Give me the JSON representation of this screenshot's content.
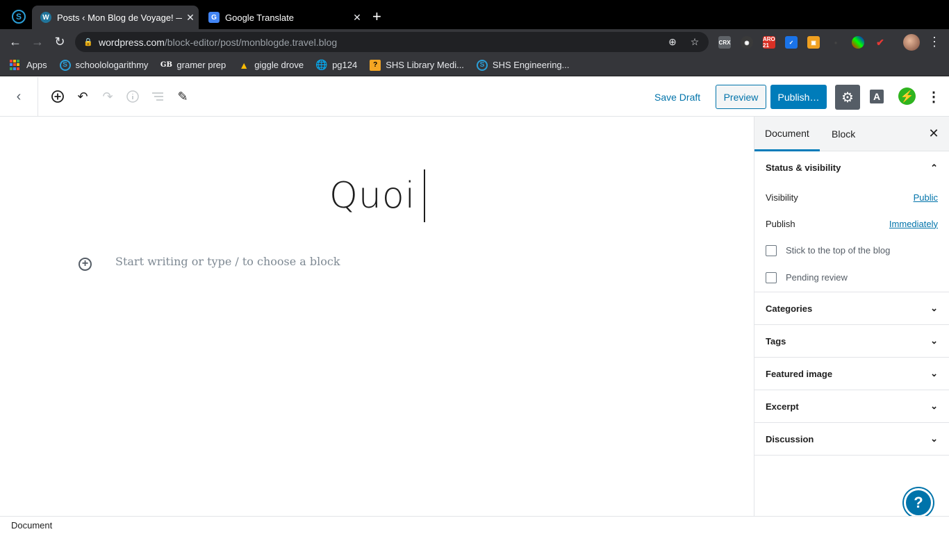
{
  "browser": {
    "tabs": [
      {
        "title": "Posts ‹ Mon Blog de Voyage! — ",
        "close": "✕"
      },
      {
        "title": "Google Translate",
        "close": "✕"
      }
    ],
    "new_tab": "+",
    "url_host": "wordpress.com",
    "url_path": "/block-editor/post/monblogde.travel.blog",
    "bookmarks": [
      {
        "label": "Apps"
      },
      {
        "label": "schoolologarithmy"
      },
      {
        "label": "gramer prep"
      },
      {
        "label": "giggle drove"
      },
      {
        "label": "pg124"
      },
      {
        "label": "SHS Library Medi..."
      },
      {
        "label": "SHS Engineering..."
      }
    ],
    "extensions": [
      "CRX",
      "ARO 21"
    ]
  },
  "editor": {
    "save_draft": "Save Draft",
    "preview": "Preview",
    "publish": "Publish…",
    "font_button": "A",
    "post_title": "Quoi",
    "placeholder": "Start writing or type / to choose a block"
  },
  "sidebar": {
    "tabs": [
      {
        "label": "Document"
      },
      {
        "label": "Block"
      }
    ],
    "close": "✕",
    "status_panel": {
      "title": "Status & visibility",
      "visibility_label": "Visibility",
      "visibility_value": "Public",
      "publish_label": "Publish",
      "publish_value": "Immediately",
      "stick_label": "Stick to the top of the blog",
      "pending_label": "Pending review"
    },
    "panels": [
      {
        "title": "Categories"
      },
      {
        "title": "Tags"
      },
      {
        "title": "Featured image"
      },
      {
        "title": "Excerpt"
      },
      {
        "title": "Discussion"
      }
    ]
  },
  "footer": {
    "breadcrumb": "Document"
  },
  "colors": {
    "accent": "#007cba",
    "link": "#0073aa",
    "jetpack": "#2fb41f"
  }
}
